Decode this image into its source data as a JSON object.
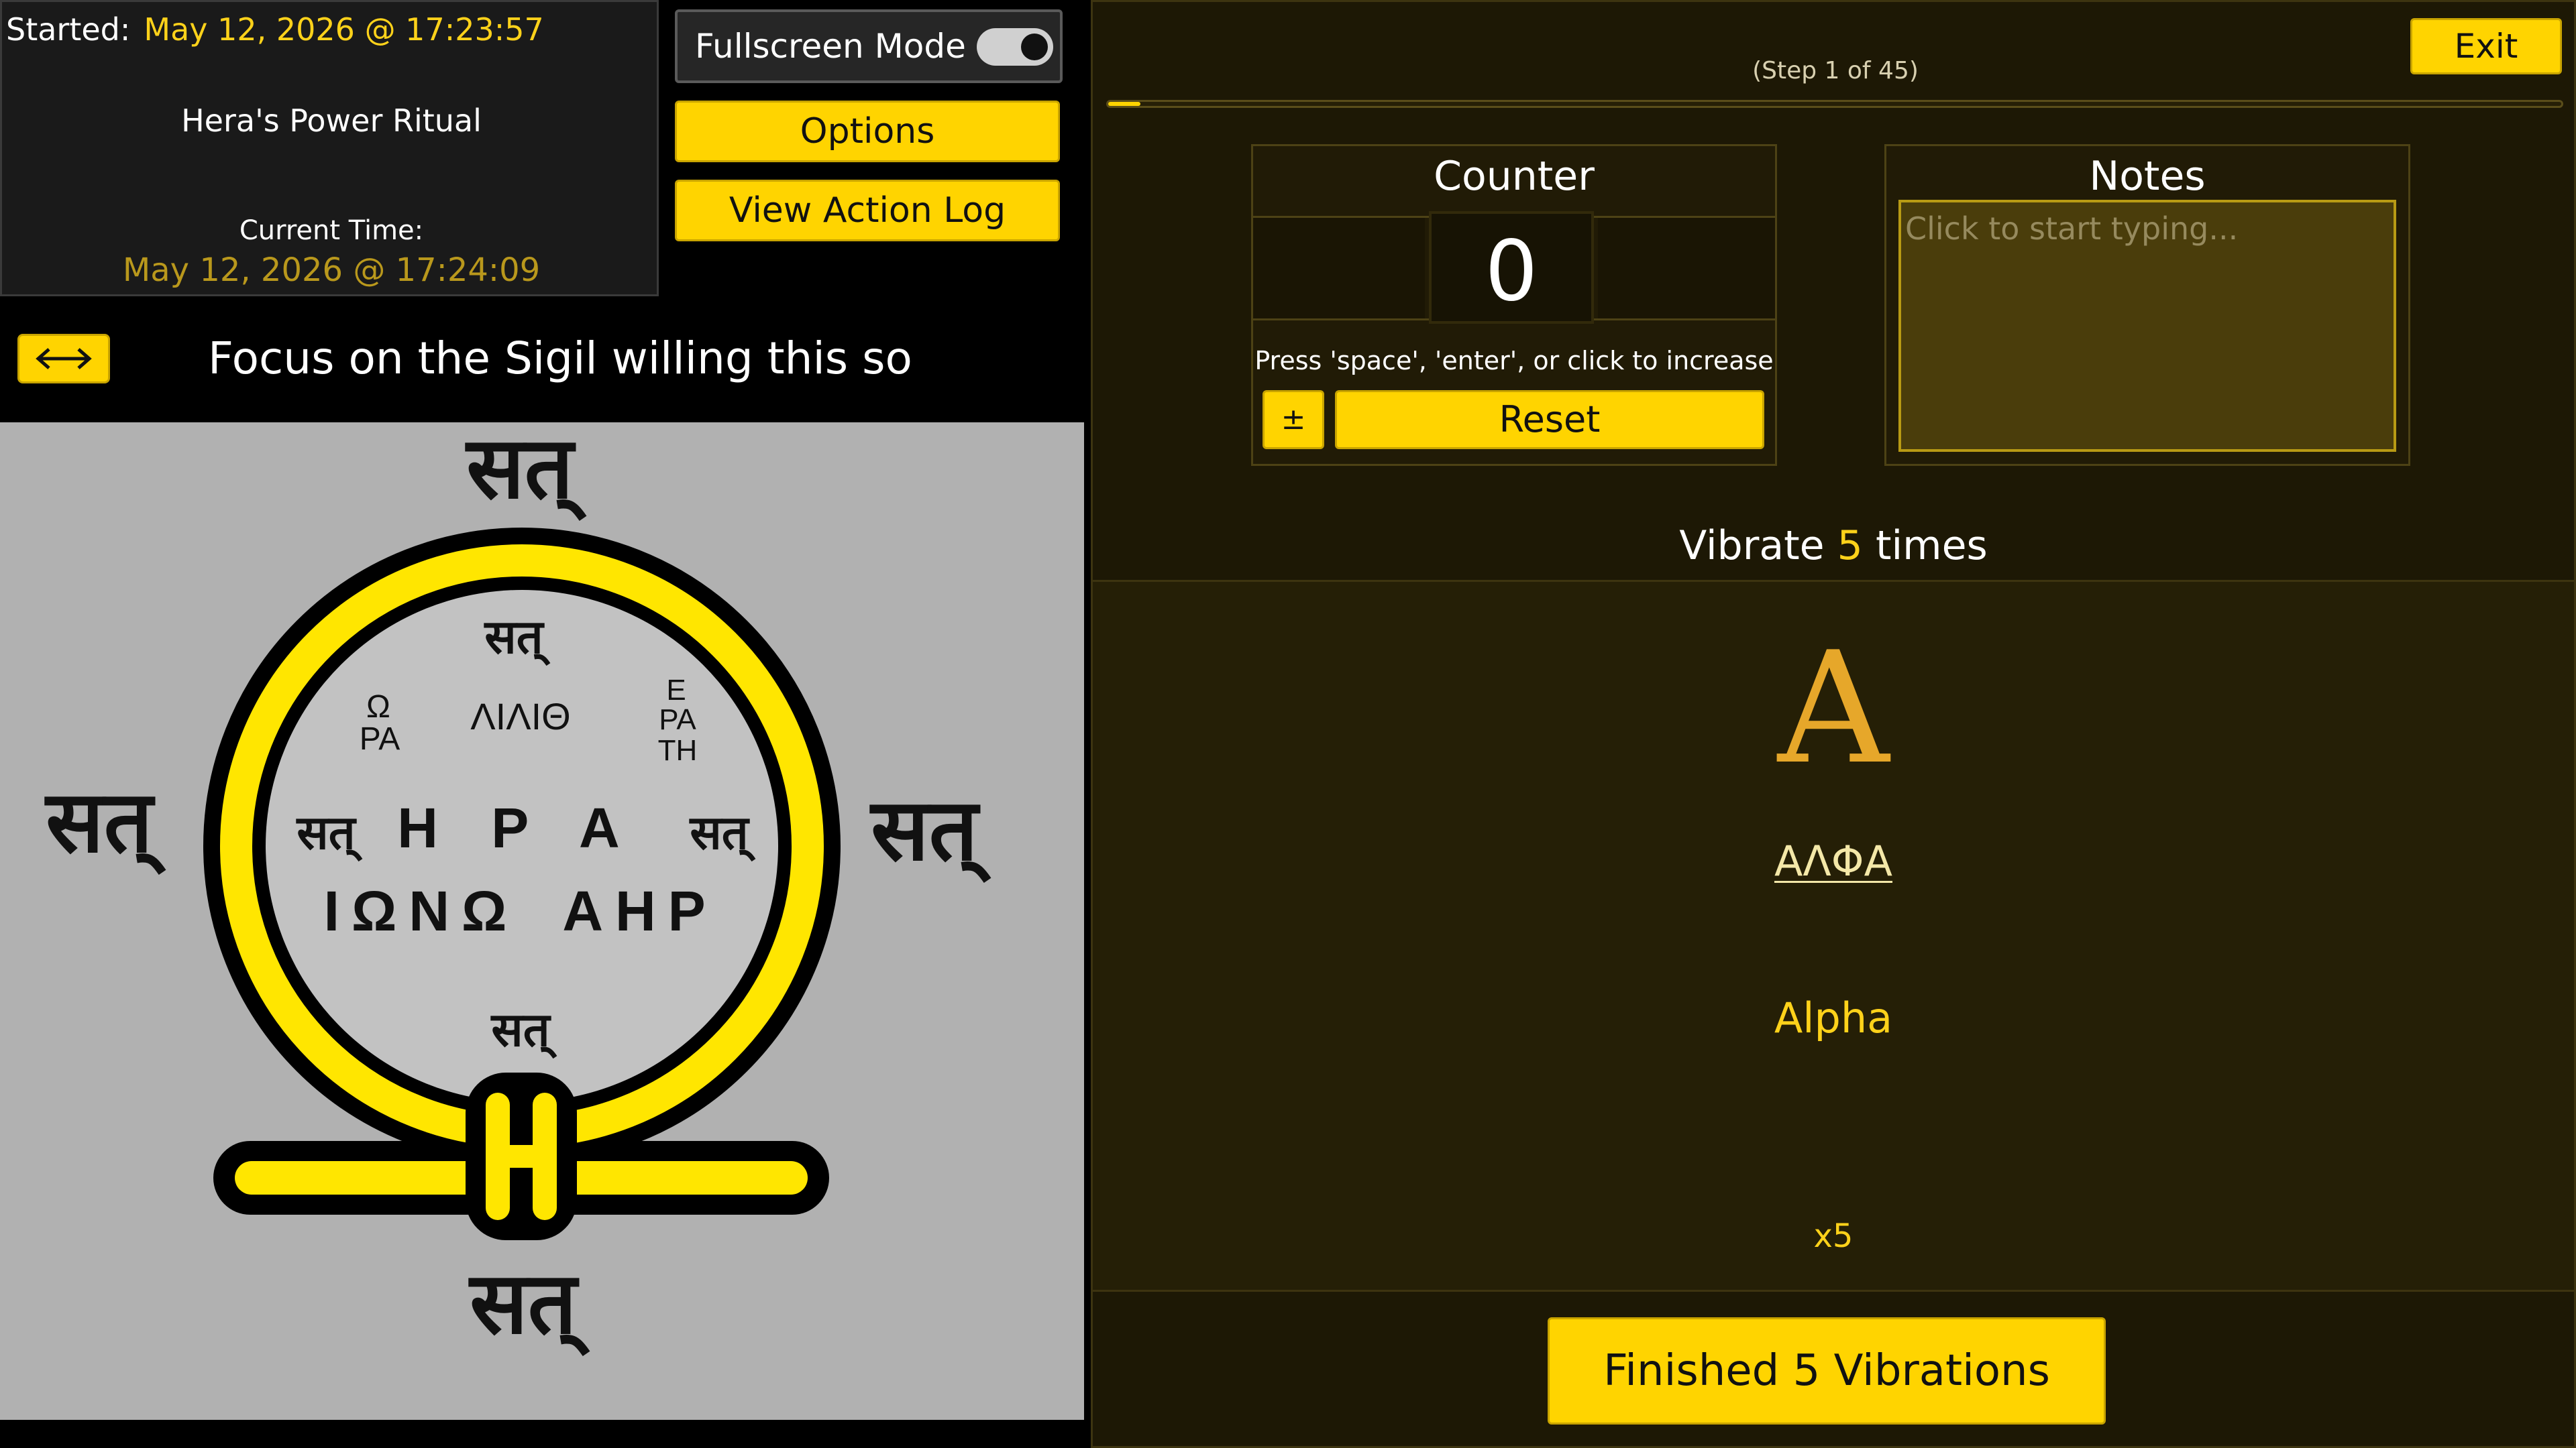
{
  "session": {
    "started_label": "Started:",
    "started_value": "May 12, 2026 @ 17:23:57",
    "ritual_name": "Hera's Power Ritual",
    "current_time_label": "Current Time:",
    "current_time_value": "May 12, 2026 @ 17:24:09"
  },
  "controls": {
    "fullscreen_label": "Fullscreen Mode",
    "fullscreen_on": true,
    "options_label": "Options",
    "action_log_label": "View Action Log",
    "swap_icon": "↔"
  },
  "instruction": {
    "focus_text": "Focus on the Sigil willing this so"
  },
  "sigil": {
    "outer_word": "सत्",
    "inner_top": "सत्",
    "inner_bottom": "सत्",
    "left_side": "सत्",
    "right_side": "सत्",
    "upper_left": [
      "Ω",
      "PA"
    ],
    "upper_center": "ΛΙΛΙΘ",
    "upper_right": [
      "E",
      "PA",
      "TH"
    ],
    "line1": "H P A",
    "line2_left": "IΩNΩ",
    "line2_right": "AHP"
  },
  "step": {
    "label": "(Step 1 of 45)",
    "current": 1,
    "total": 45,
    "progress_fraction": 0.0222,
    "exit_label": "Exit"
  },
  "counter": {
    "title": "Counter",
    "value": "0",
    "hint": "Press 'space', 'enter', or click to increase",
    "plus_minus_label": "±",
    "reset_label": "Reset"
  },
  "notes": {
    "title": "Notes",
    "placeholder": "Click to start typing..."
  },
  "vibration": {
    "prefix": "Vibrate",
    "count": "5",
    "suffix": "times",
    "letter": "A",
    "greek_word": "ΑΛΦΑ",
    "latin_name": "Alpha",
    "multiplier": "x5",
    "finish_prefix": "Finished",
    "finish_count": "5",
    "finish_suffix": "Vibrations"
  },
  "colors": {
    "accent": "#ffd400",
    "panel_bg": "#1d1805",
    "sigil_bg": "#b1b1b1"
  }
}
